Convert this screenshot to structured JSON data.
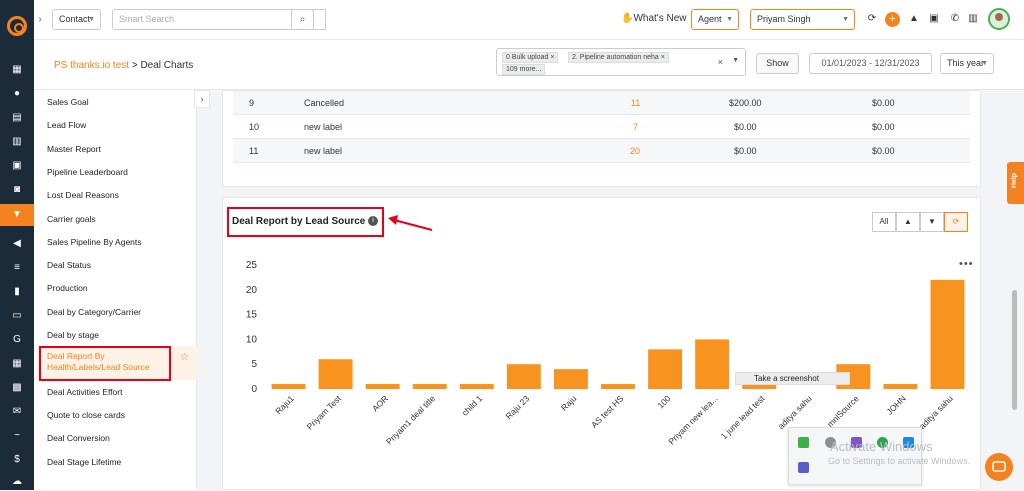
{
  "topbar": {
    "contact_select": "Contact",
    "search_placeholder": "Smart Search",
    "whats_new": "What's New",
    "role_select": "Agent",
    "user_select": "Priyam Singh"
  },
  "header": {
    "breadcrumb_parent": "PS thanks.io test",
    "breadcrumb_sep": " > ",
    "breadcrumb_current": "Deal Charts",
    "pipeline_chips": [
      "0 Bulk upload",
      "2. Pipeline automation neha",
      "109 more..."
    ],
    "show_label": "Show",
    "date_range": "01/01/2023 - 12/31/2023",
    "period_select": "This year"
  },
  "sidebar": {
    "items": [
      "Sales Goal",
      "Lead Flow",
      "Master Report",
      "Pipeline Leaderboard",
      "Lost Deal Reasons",
      "Carrier goals",
      "Sales Pipeline By Agents",
      "Deal Status",
      "Production",
      "Deal by Category/Carrier",
      "Deal by stage",
      "Deal Report By Health/Labels/Lead Source",
      "Deal Activities Effort",
      "Quote to close cards",
      "Deal Conversion",
      "Deal Stage Lifetime"
    ]
  },
  "table": {
    "rows": [
      {
        "id": "9",
        "label": "Cancelled",
        "count": "11",
        "amount": "$200.00",
        "value": "$0.00"
      },
      {
        "id": "10",
        "label": "new label",
        "count": "7",
        "amount": "$0.00",
        "value": "$0.00"
      },
      {
        "id": "11",
        "label": "new label",
        "count": "20",
        "amount": "$0.00",
        "value": "$0.00"
      }
    ]
  },
  "chart_card": {
    "title": "Deal Report by Lead Source",
    "filters": [
      "All",
      "thumbs-up-icon",
      "thumbs-down-icon",
      "refresh-icon"
    ],
    "filter_all_label": "All"
  },
  "chart_data": {
    "type": "bar",
    "title": "Deal Report by Lead Source",
    "categories": [
      "Raju1",
      "Priyam Test",
      "AOR",
      "Priyam1 deal title",
      "child 1",
      "Raju 23",
      "Raju",
      "AS test HS",
      "100",
      "Priyam new lea...",
      "1 june lead test",
      "aditya sahu",
      "mnlSource",
      "JOHN",
      "aditya sahu"
    ],
    "values": [
      1,
      6,
      1,
      1,
      1,
      5,
      4,
      1,
      8,
      10,
      1,
      0,
      5,
      1,
      22
    ],
    "yticks": [
      "0",
      "5",
      "10",
      "15",
      "20",
      "25"
    ],
    "ylim": [
      0,
      25
    ],
    "color": "#f7931e",
    "legend": "none"
  },
  "overlay": {
    "screenshot_tip": "Take a screenshot",
    "activate_title": "Activate Windows",
    "activate_sub": "Go to Settings to activate Windows.",
    "help_label": "Help"
  },
  "colors": {
    "accent": "#f58220",
    "nav_bg": "#1c2b3a",
    "highlight_red": "#e8001a"
  }
}
